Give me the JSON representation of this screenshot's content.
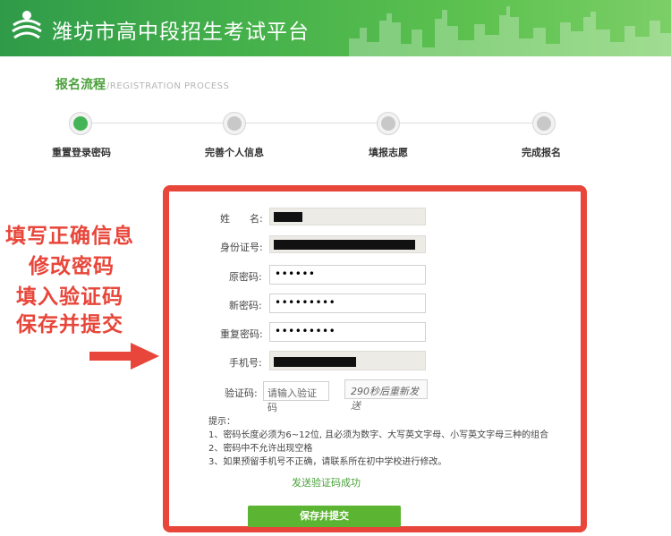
{
  "header": {
    "site_title": "潍坊市高中段招生考试平台"
  },
  "process": {
    "title_cn": "报名流程",
    "title_en": "/REGISTRATION PROCESS",
    "steps": [
      {
        "label": "重置登录密码",
        "active": true
      },
      {
        "label": "完善个人信息",
        "active": false
      },
      {
        "label": "填报志愿",
        "active": false
      },
      {
        "label": "完成报名",
        "active": false
      }
    ]
  },
  "annotation": {
    "lines": [
      "填写正确信息",
      "修改密码",
      "填入验证码",
      "保存并提交"
    ],
    "arrow_icon": "right-arrow-icon",
    "color": "#e8463a"
  },
  "form": {
    "name_label": "姓　　名:",
    "id_label": "身份证号:",
    "old_pwd_label": "原密码:",
    "old_pwd_value": "••••••",
    "new_pwd_label": "新密码:",
    "new_pwd_value": "•••••••••",
    "repeat_pwd_label": "重复密码:",
    "repeat_pwd_value": "•••••••••",
    "phone_label": "手机号:",
    "captcha_label": "验证码:",
    "captcha_placeholder": "请输入验证码",
    "resend_label": "290秒后重新发送"
  },
  "tips": {
    "title": "提示：",
    "items": [
      "1、密码长度必须为6~12位, 且必须为数字、大写英文字母、小写英文字母三种的组合",
      "2、密码中不允许出现空格",
      "3、如果预留手机号不正确，请联系所在初中学校进行修改。"
    ]
  },
  "status": {
    "sms_success": "发送验证码成功"
  },
  "actions": {
    "submit_label": "保存并提交"
  },
  "colors": {
    "brand_green": "#44b04b",
    "highlight_red": "#e8463a",
    "button_green": "#5cb532"
  }
}
